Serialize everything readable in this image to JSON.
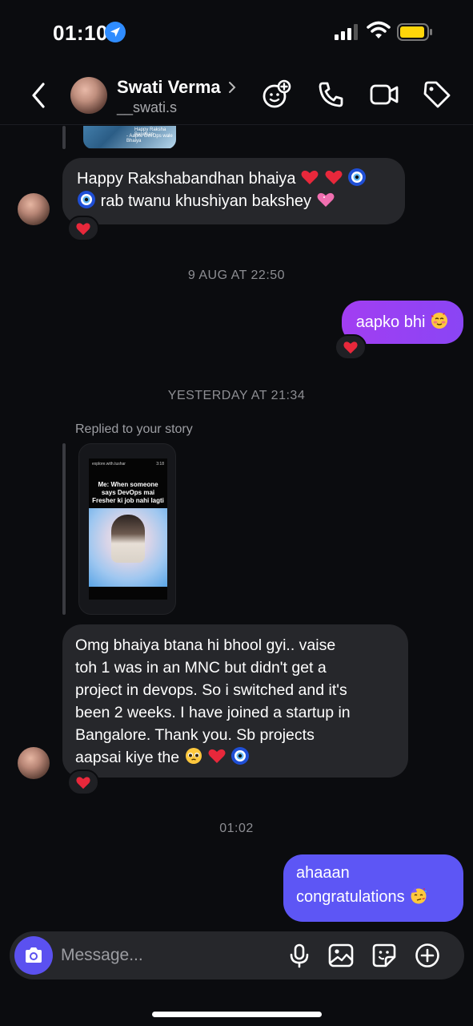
{
  "status_bar": {
    "time": "01:10"
  },
  "header": {
    "contact_name": "Swati Verma",
    "username": "__swati.s"
  },
  "top_thumbnail": {
    "caption_line1": "Happy Raksha Bandhan",
    "caption_line2": "- Aapke DevOps wale Bhaiya"
  },
  "messages": [
    {
      "id": "m1",
      "direction": "incoming",
      "text_line1": "Happy Rakshabandhan bhaiya",
      "text_line2": "rab twanu khushiyan bakshey",
      "reaction": "heart"
    },
    {
      "id": "ts1",
      "type": "timestamp",
      "text": "9 AUG AT 22:50"
    },
    {
      "id": "m2",
      "direction": "outgoing",
      "text": "aapko bhi",
      "reaction": "heart"
    },
    {
      "id": "ts2",
      "type": "timestamp",
      "text": "YESTERDAY AT 21:34"
    },
    {
      "id": "story",
      "type": "story_reply",
      "label": "Replied to your story",
      "story_text": "Me: When someone says DevOps mai Fresher ki job nahi lagti",
      "story_user": "explore.with.tushar",
      "story_time": "3:18"
    },
    {
      "id": "m3",
      "direction": "incoming",
      "lines": [
        "Omg bhaiya btana hi bhool gyi.. vaise",
        "toh 1 was in an MNC but didn't get a",
        "project in devops. So i switched and it's",
        "been 2 weeks. I have joined a startup in",
        "Bangalore. Thank you. Sb projects",
        "aapsai kiye the"
      ],
      "reaction": "heart"
    },
    {
      "id": "ts3",
      "type": "timestamp",
      "text": "01:02"
    },
    {
      "id": "m4",
      "direction": "outgoing",
      "lines": [
        "ahaaan",
        "congratulations"
      ]
    }
  ],
  "composer": {
    "placeholder": "Message..."
  },
  "colors": {
    "background": "#0b0c0f",
    "incoming_bubble": "#26272b",
    "outgoing_gradient_start": "#a23ef2",
    "outgoing_gradient_end": "#5d56f5",
    "camera_button": "#5b51f0",
    "heart": "#e8283b"
  },
  "icons": [
    "location-arrow-icon",
    "signal-icon",
    "wifi-icon",
    "battery-icon",
    "back-icon",
    "chevron-right-icon",
    "effects-icon",
    "call-icon",
    "video-icon",
    "tag-icon",
    "camera-icon",
    "mic-icon",
    "gallery-icon",
    "sticker-icon",
    "plus-icon",
    "heart-icon"
  ]
}
